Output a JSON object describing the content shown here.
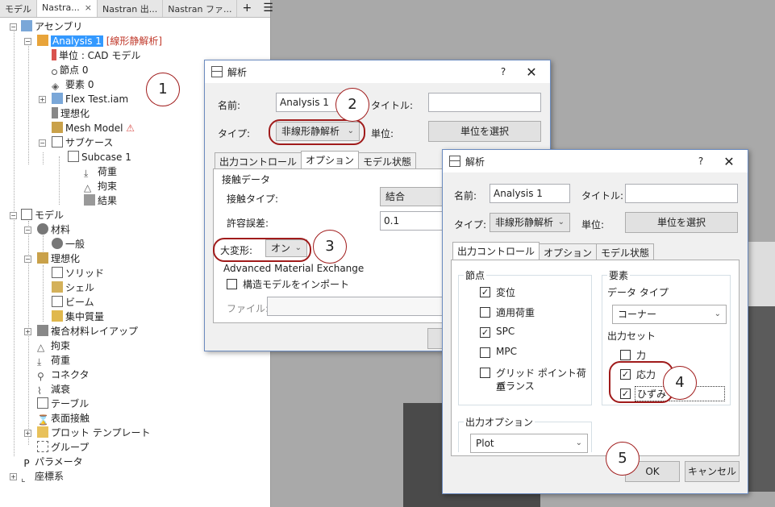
{
  "browser": {
    "tabs": [
      "モデル",
      "Nastra...",
      "Nastran 出...",
      "Nastran ファ..."
    ],
    "tab_add": "+",
    "tab_menu": "☰",
    "tree": {
      "assembly": "アセンブリ",
      "analysis": "Analysis 1",
      "analysis_type": "[線形静解析]",
      "units": "単位 : CAD モデル",
      "nodes": "節点 0",
      "elements": "要素 0",
      "flex": "Flex Test.iam",
      "idealize_a": "理想化",
      "mesh": "Mesh Model",
      "subcase_group": "サブケース",
      "subcase1": "Subcase 1",
      "load_a": "荷重",
      "constraint_a": "拘束",
      "results": "結果",
      "model": "モデル",
      "material": "材料",
      "general": "一般",
      "idealize_b": "理想化",
      "solid": "ソリッド",
      "shell": "シェル",
      "beam": "ビーム",
      "mass": "集中質量",
      "layup": "複合材料レイアップ",
      "constraint_b": "拘束",
      "load_b": "荷重",
      "connector": "コネクタ",
      "damping": "減衰",
      "table": "テーブル",
      "contact": "表面接触",
      "plot_template": "プロット テンプレート",
      "group": "グループ",
      "params": "パラメータ",
      "coord": "座標系"
    }
  },
  "dialog1": {
    "title": "解析",
    "help": "?",
    "close": "✕",
    "name_label": "名前:",
    "name_value": "Analysis 1",
    "title_label": "タイトル:",
    "title_value": "",
    "type_label": "タイプ:",
    "type_value": "非線形静解析",
    "unit_label": "単位:",
    "unit_button": "単位を選択",
    "tabs": [
      "出力コントロール",
      "オプション",
      "モデル状態"
    ],
    "contact_group": "接触データ",
    "contact_type_label": "接触タイプ:",
    "contact_type_value": "結合",
    "tolerance_label": "許容誤差:",
    "tolerance_value": "0.1",
    "large_def_label": "大変形:",
    "large_def_value": "オン",
    "ame_group": "Advanced Material Exchange",
    "import_label": "構造モデルをインポート",
    "file_label": "ファイル:"
  },
  "dialog2": {
    "title": "解析",
    "help": "?",
    "close": "✕",
    "name_label": "名前:",
    "name_value": "Analysis 1",
    "title_label": "タイトル:",
    "title_value": "",
    "type_label": "タイプ:",
    "type_value": "非線形静解析",
    "unit_label": "単位:",
    "unit_button": "単位を選択",
    "tabs": [
      "出力コントロール",
      "オプション",
      "モデル状態"
    ],
    "nodes_group": "節点",
    "node_items": [
      {
        "label": "変位",
        "checked": true
      },
      {
        "label": "適用荷重",
        "checked": false
      },
      {
        "label": "SPC",
        "checked": true
      },
      {
        "label": "MPC",
        "checked": false
      },
      {
        "label": "グリッド ポイント荷重",
        "label2": "バランス",
        "checked": false
      }
    ],
    "elements_group": "要素",
    "data_type_label": "データ タイプ",
    "data_type_value": "コーナー",
    "output_set_label": "出力セット",
    "elem_items": [
      {
        "label": "力",
        "checked": false
      },
      {
        "label": "応力",
        "checked": true
      },
      {
        "label": "ひずみ",
        "checked": true
      }
    ],
    "output_options_group": "出力オプション",
    "output_options_value": "Plot",
    "ok": "OK",
    "cancel": "キャンセル"
  },
  "callouts": [
    "1",
    "2",
    "3",
    "4",
    "5"
  ],
  "colors": {
    "highlight": "#a01b1b",
    "selection": "#3399ff",
    "accent_red": "#c0392b"
  }
}
